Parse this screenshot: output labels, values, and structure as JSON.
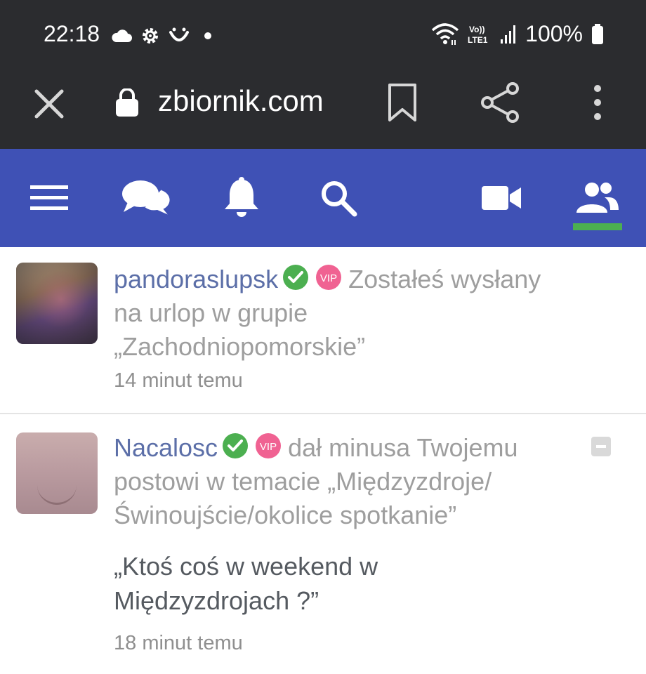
{
  "status_bar": {
    "time": "22:18",
    "battery": "100%",
    "left_icons": [
      "cloud-icon",
      "settings-gear-icon",
      "smile-icon",
      "dot-icon"
    ],
    "right_icons": [
      "wifi-icon",
      "volte-lte1-icon",
      "signal-icon",
      "battery-icon"
    ],
    "volte_label": "Vo))\nLTE1"
  },
  "browser": {
    "url": "zbiornik.com",
    "icons": [
      "close-icon",
      "lock-icon",
      "bookmark-icon",
      "share-icon",
      "more-vert-icon"
    ]
  },
  "site_nav": {
    "items": [
      {
        "name": "menu",
        "icon": "hamburger-icon"
      },
      {
        "name": "messages",
        "icon": "chat-bubbles-icon"
      },
      {
        "name": "notifications",
        "icon": "bell-icon"
      },
      {
        "name": "search",
        "icon": "search-icon"
      },
      {
        "name": "video",
        "icon": "video-camera-icon"
      },
      {
        "name": "friends",
        "icon": "people-icon",
        "active": true
      }
    ],
    "colors": {
      "bar": "#3f51b5",
      "active_underline": "#4caf50"
    }
  },
  "notifications": [
    {
      "username": "pandoraslupsk",
      "badges": [
        "verified-check-icon",
        "vip-badge"
      ],
      "vip_label": "VIP",
      "message_line1": "Zostałeś wysłany",
      "message_line2": "na urlop w grupie",
      "message_line3": "„Zachodniopomorskie”",
      "time": "14 minut temu"
    },
    {
      "username": "Nacalosc",
      "badges": [
        "verified-check-icon",
        "vip-badge"
      ],
      "vip_label": "VIP",
      "message_line1": "dał minusa Twojemu",
      "message_line2": "postowi w temacie „Międzyzdroje/",
      "message_line3": "Świnoujście/okolice spotkanie”",
      "quote_line1": "„Ktoś coś w weekend w",
      "quote_line2": "Międzyzdrojach ?”",
      "time": "18 minut temu",
      "action_icon": "minus-icon"
    }
  ],
  "colors": {
    "username": "#5c6fa8",
    "verified": "#4caf50",
    "vip": "#f06292",
    "muted_text": "#9e9e9e"
  }
}
